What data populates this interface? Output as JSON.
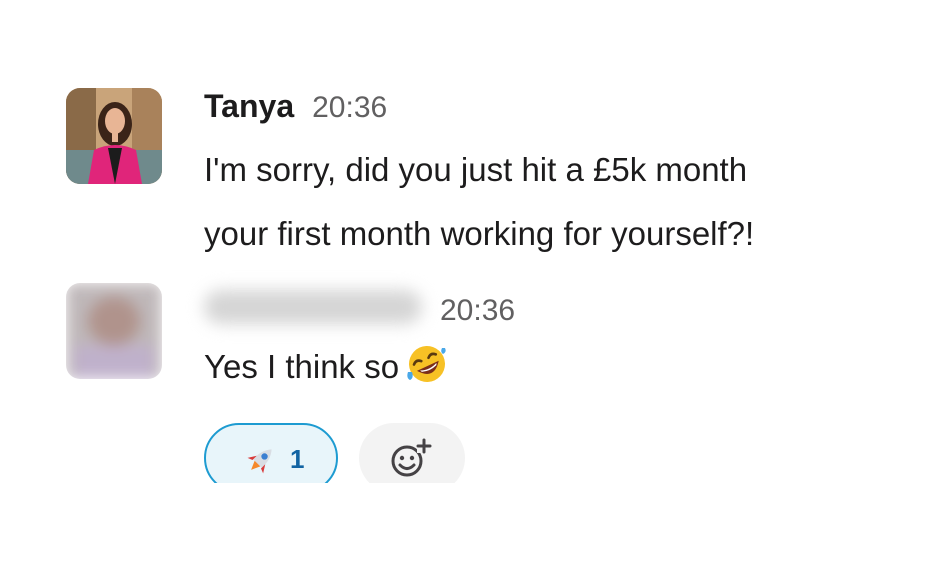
{
  "messages": [
    {
      "sender": "Tanya",
      "time": "20:36",
      "text_line1": "I'm sorry, did you just hit a £5k month",
      "text_line2": "your first month working for yourself?!"
    },
    {
      "sender": "",
      "time": "20:36",
      "text": "Yes I think so",
      "inline_emoji": "rolling-on-floor-laughing",
      "reactions": [
        {
          "emoji": "rocket",
          "count": "1",
          "active": true
        }
      ],
      "add_reaction_icon": "add-reaction-icon"
    }
  ],
  "colors": {
    "reaction_border": "#1d9bd1",
    "reaction_bg": "#e8f5fa",
    "reaction_count": "#1264a3",
    "timestamp": "#616061",
    "text": "#1d1c1d"
  }
}
